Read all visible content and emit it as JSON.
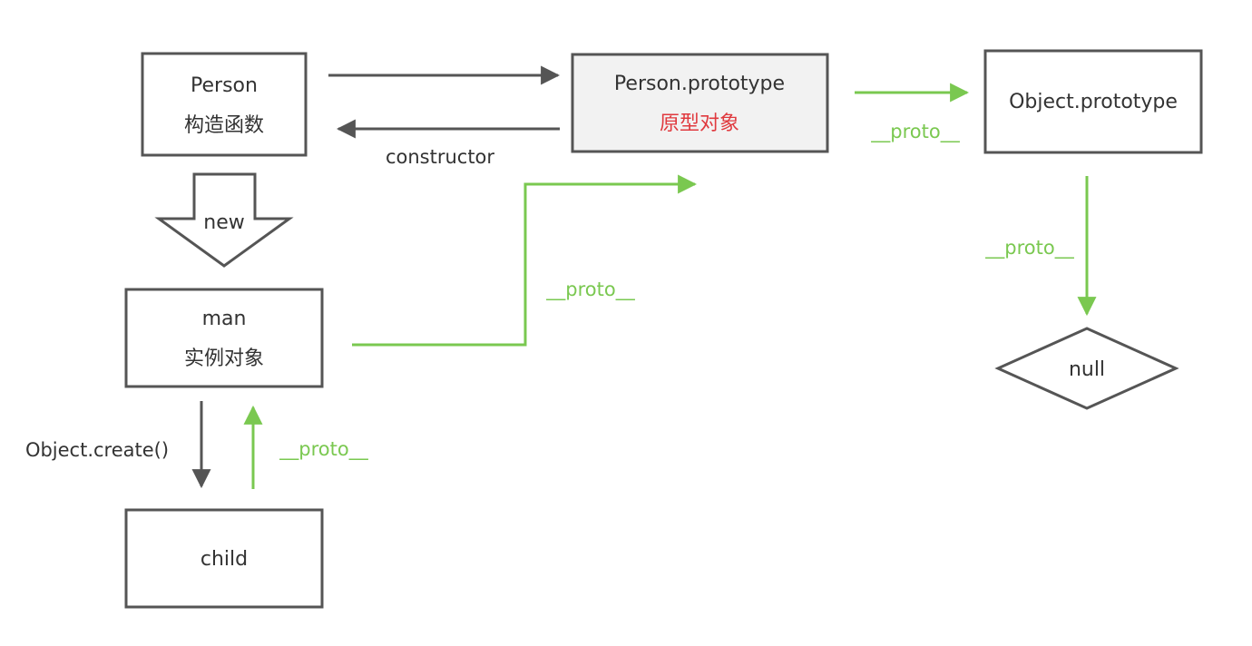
{
  "nodes": {
    "person": {
      "line1": "Person",
      "line2": "构造函数"
    },
    "person_prototype": {
      "line1": "Person.prototype",
      "line2": "原型对象"
    },
    "object_prototype": {
      "line1": "Object.prototype"
    },
    "man": {
      "line1": "man",
      "line2": "实例对象"
    },
    "child": {
      "line1": "child"
    },
    "null": {
      "line1": "null"
    }
  },
  "edges": {
    "constructor": "constructor",
    "new": "new",
    "object_create": "Object.create()",
    "proto_man_to_prototype": "__proto__",
    "proto_prototype_to_object": "__proto__",
    "proto_object_to_null": "__proto__",
    "proto_child_to_man": "__proto__"
  },
  "colors": {
    "dark": "#555555",
    "green": "#7ac850",
    "red": "#e0393e",
    "highlight_fill": "#f2f2f2"
  }
}
